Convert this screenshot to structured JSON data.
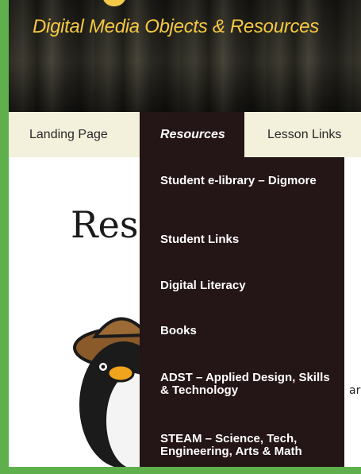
{
  "header": {
    "tagline": "Digital Media Objects & Resources"
  },
  "nav": {
    "items": [
      {
        "label": "Landing Page"
      },
      {
        "label": "Resources"
      },
      {
        "label": "Lesson Links"
      }
    ]
  },
  "dropdown": {
    "items": [
      {
        "label": "Student e-library – Digmore"
      },
      {
        "label": "Student Links"
      },
      {
        "label": "Digital Literacy"
      },
      {
        "label": "Books"
      },
      {
        "label": "ADST – Applied Design, Skills & Technology"
      },
      {
        "label": "STEAM – Science, Tech, Engineering, Arts & Math"
      }
    ]
  },
  "main": {
    "heading": "Res",
    "side_text": "ar"
  },
  "colors": {
    "accent": "#f5c842",
    "frame": "#5fb04c",
    "nav_bg": "#f3f0db",
    "dropdown_bg": "#241517"
  }
}
